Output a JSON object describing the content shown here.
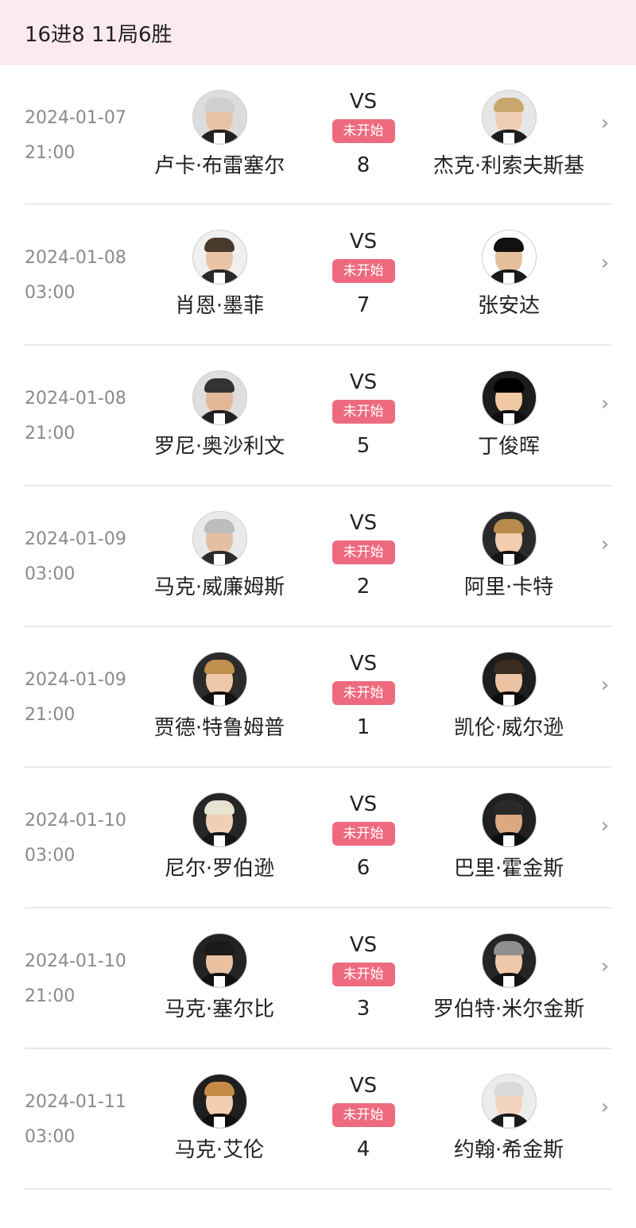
{
  "header": {
    "title": "16进8 11局6胜"
  },
  "status_label": "未开始",
  "vs_label": "VS",
  "matches": [
    {
      "date": "2024-01-07",
      "time": "21:00",
      "home": "卢卡·布雷塞尔",
      "away": "杰克·利索夫斯基",
      "order": "8"
    },
    {
      "date": "2024-01-08",
      "time": "03:00",
      "home": "肖恩·墨菲",
      "away": "张安达",
      "order": "7"
    },
    {
      "date": "2024-01-08",
      "time": "21:00",
      "home": "罗尼·奥沙利文",
      "away": "丁俊晖",
      "order": "5"
    },
    {
      "date": "2024-01-09",
      "time": "03:00",
      "home": "马克·威廉姆斯",
      "away": "阿里·卡特",
      "order": "2"
    },
    {
      "date": "2024-01-09",
      "time": "21:00",
      "home": "贾德·特鲁姆普",
      "away": "凯伦·威尔逊",
      "order": "1"
    },
    {
      "date": "2024-01-10",
      "time": "03:00",
      "home": "尼尔·罗伯逊",
      "away": "巴里·霍金斯",
      "order": "6"
    },
    {
      "date": "2024-01-10",
      "time": "21:00",
      "home": "马克·塞尔比",
      "away": "罗伯特·米尔金斯",
      "order": "3"
    },
    {
      "date": "2024-01-11",
      "time": "03:00",
      "home": "马克·艾伦",
      "away": "约翰·希金斯",
      "order": "4"
    }
  ],
  "colors": {
    "header_bg": "#fbeaee",
    "status_bg": "#ee6a7f",
    "divider": "#e8e8e8",
    "date_text": "#8a8a8a"
  },
  "icons": {
    "chevron": "chevron-right-icon",
    "avatar": "player-avatar-photo"
  }
}
